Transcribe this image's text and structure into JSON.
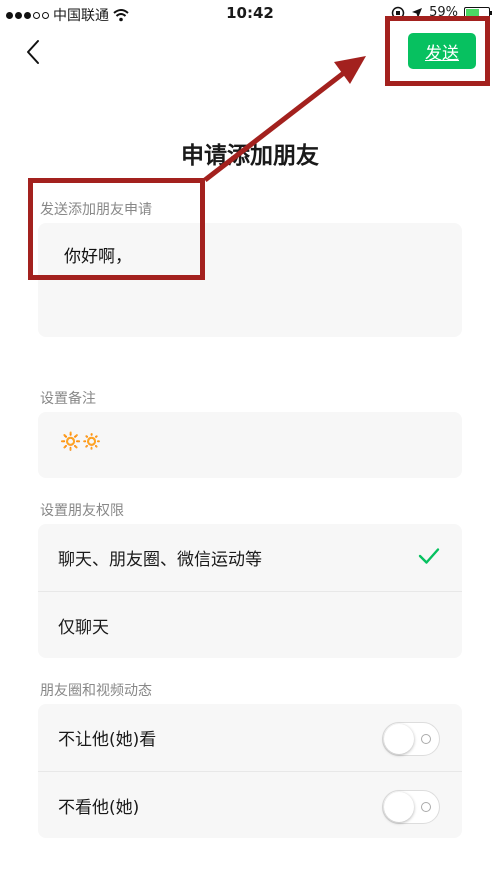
{
  "status": {
    "carrier": "中国联通",
    "time": "10:42",
    "battery": "59%",
    "battery_level": 0.59
  },
  "header": {
    "send_label": "发送"
  },
  "page_title": "申请添加朋友",
  "request": {
    "label": "发送添加朋友申请",
    "value": "你好啊，"
  },
  "remark": {
    "label": "设置备注",
    "value": "🔆🔅"
  },
  "permissions": {
    "label": "设置朋友权限",
    "options": [
      "聊天、朋友圈、微信运动等",
      "仅聊天"
    ],
    "selected_index": 0
  },
  "moments": {
    "label": "朋友圈和视频动态",
    "items": [
      {
        "label": "不让他(她)看",
        "enabled": false
      },
      {
        "label": "不看他(她)",
        "enabled": false
      }
    ]
  },
  "colors": {
    "accent": "#07c160",
    "annotation": "#a3211e"
  }
}
